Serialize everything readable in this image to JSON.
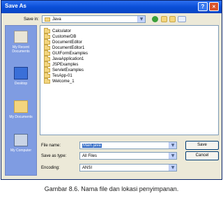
{
  "window": {
    "title": "Save As",
    "help_glyph": "?",
    "close_glyph": "×"
  },
  "toolbar": {
    "save_in_label": "Save in:",
    "save_in_value": "Java",
    "icons": [
      "back-icon",
      "up-folder-icon",
      "new-folder-icon",
      "views-menu-icon"
    ]
  },
  "places": [
    {
      "label": "My Recent Documents",
      "icon": "recent-documents-icon"
    },
    {
      "label": "Desktop",
      "icon": "desktop-icon"
    },
    {
      "label": "My Documents",
      "icon": "my-documents-icon"
    },
    {
      "label": "My Computer",
      "icon": "my-computer-icon"
    }
  ],
  "files": [
    "Calculator",
    "CustomerDB",
    "DocumentEditor",
    "DocumentEditor1",
    "GUIFormExamples",
    "JavaApplication1",
    "JSPExamples",
    "ServletExamples",
    "TesApp-01",
    "Welcome_1"
  ],
  "form": {
    "file_name_label": "File name:",
    "file_name_value": "Main.java",
    "save_type_label": "Save as type:",
    "save_type_value": "All Files",
    "encoding_label": "Encoding:",
    "encoding_value": "ANSI"
  },
  "buttons": {
    "save": "Save",
    "cancel": "Cancel"
  },
  "caption": "Gambar 8.6.  Nama file dan lokasi penyimpanan.",
  "colors": {
    "titlebar": "#0a4fd8",
    "places_bar": "#7f9ce2",
    "selection": "#316ac5",
    "folder": "#f3d57e"
  }
}
